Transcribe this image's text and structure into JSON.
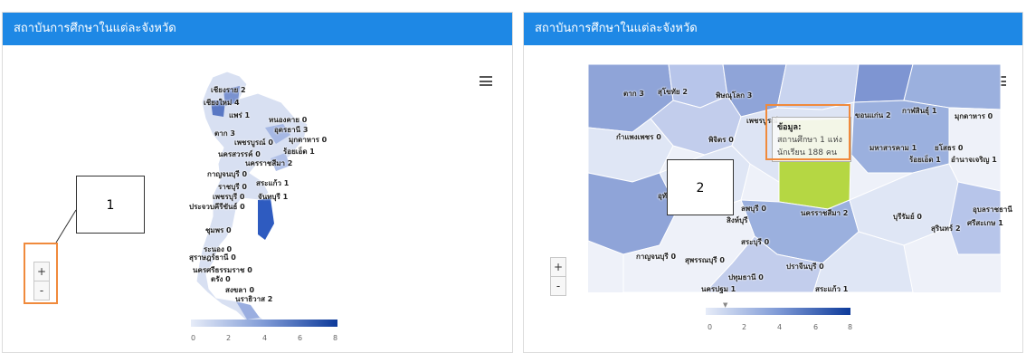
{
  "panels": [
    {
      "title": "สถาบันการศึกษาในแต่ละจังหวัด"
    },
    {
      "title": "สถาบันการศึกษาในแต่ละจังหวัด"
    }
  ],
  "zoom": {
    "in": "+",
    "out": "-"
  },
  "callouts": {
    "one": "1",
    "two": "2"
  },
  "left_map_labels": [
    "เชียงราย 2",
    "เชียงใหม่ 4",
    "แพร่ 1",
    "หนองคาย 0",
    "ตาก 3",
    "อุดรธานี 3",
    "เพชรบูรณ์ 0",
    "มุกดาหาร 0",
    "ร้อยเอ็ด 1",
    "นครสวรรค์ 0",
    "นครราชสีมา 2",
    "กาญจนบุรี 0",
    "สระแก้ว 1",
    "ราชบุรี 0",
    "เพชรบุรี 0",
    "จันทบุรี 1",
    "ประจวบคีรีขันธ์ 0",
    "ชุมพร 0",
    "ระนอง 0",
    "สุราษฎร์ธานี 0",
    "นครศรีธรรมราช 0",
    "ตรัง 0",
    "สงขลา 0",
    "นราธิวาส 2"
  ],
  "right_map_labels": [
    "ตาก 3",
    "สุโขทัย 2",
    "พิษณุโลก 3",
    "เพชรบูรณ์",
    "ขอนแก่น 2",
    "กาฬสินธุ์ 1",
    "มุกดาหาร 0",
    "กำแพงเพชร 0",
    "พิจิตร 0",
    "มหาสารคาม 1",
    "ยโสธร 0",
    "ร้อยเอ็ด 1",
    "อำนาจเจริญ 1",
    "อุทัย",
    "ลพบุรี 0",
    "นครราชสีมา 2",
    "บุรีรัมย์ 0",
    "สุรินทร์ 2",
    "ศรีสะเกษ 1",
    "อุบลราชธานี",
    "สระบุรี 0",
    "กาญจนบุรี 0",
    "สุพรรณบุรี 0",
    "ปราจีนบุรี 0",
    "ปทุมธานี 0",
    "นครปฐม 1",
    "สระแก้ว 1",
    "สิงห์บุรี"
  ],
  "tooltip": {
    "title": "ข้อมูล:",
    "line1": "สถานศึกษา 1 แห่ง",
    "line2": "นักเรียน 188 คน"
  },
  "legend_ticks": [
    "0",
    "2",
    "4",
    "6",
    "8"
  ],
  "colors": {
    "header": "#1e88e5",
    "highlight_orange": "#f08a3c",
    "map_low": "#e6ecf8",
    "map_high": "#0d3a9a",
    "selected_region": "#b5d743"
  }
}
